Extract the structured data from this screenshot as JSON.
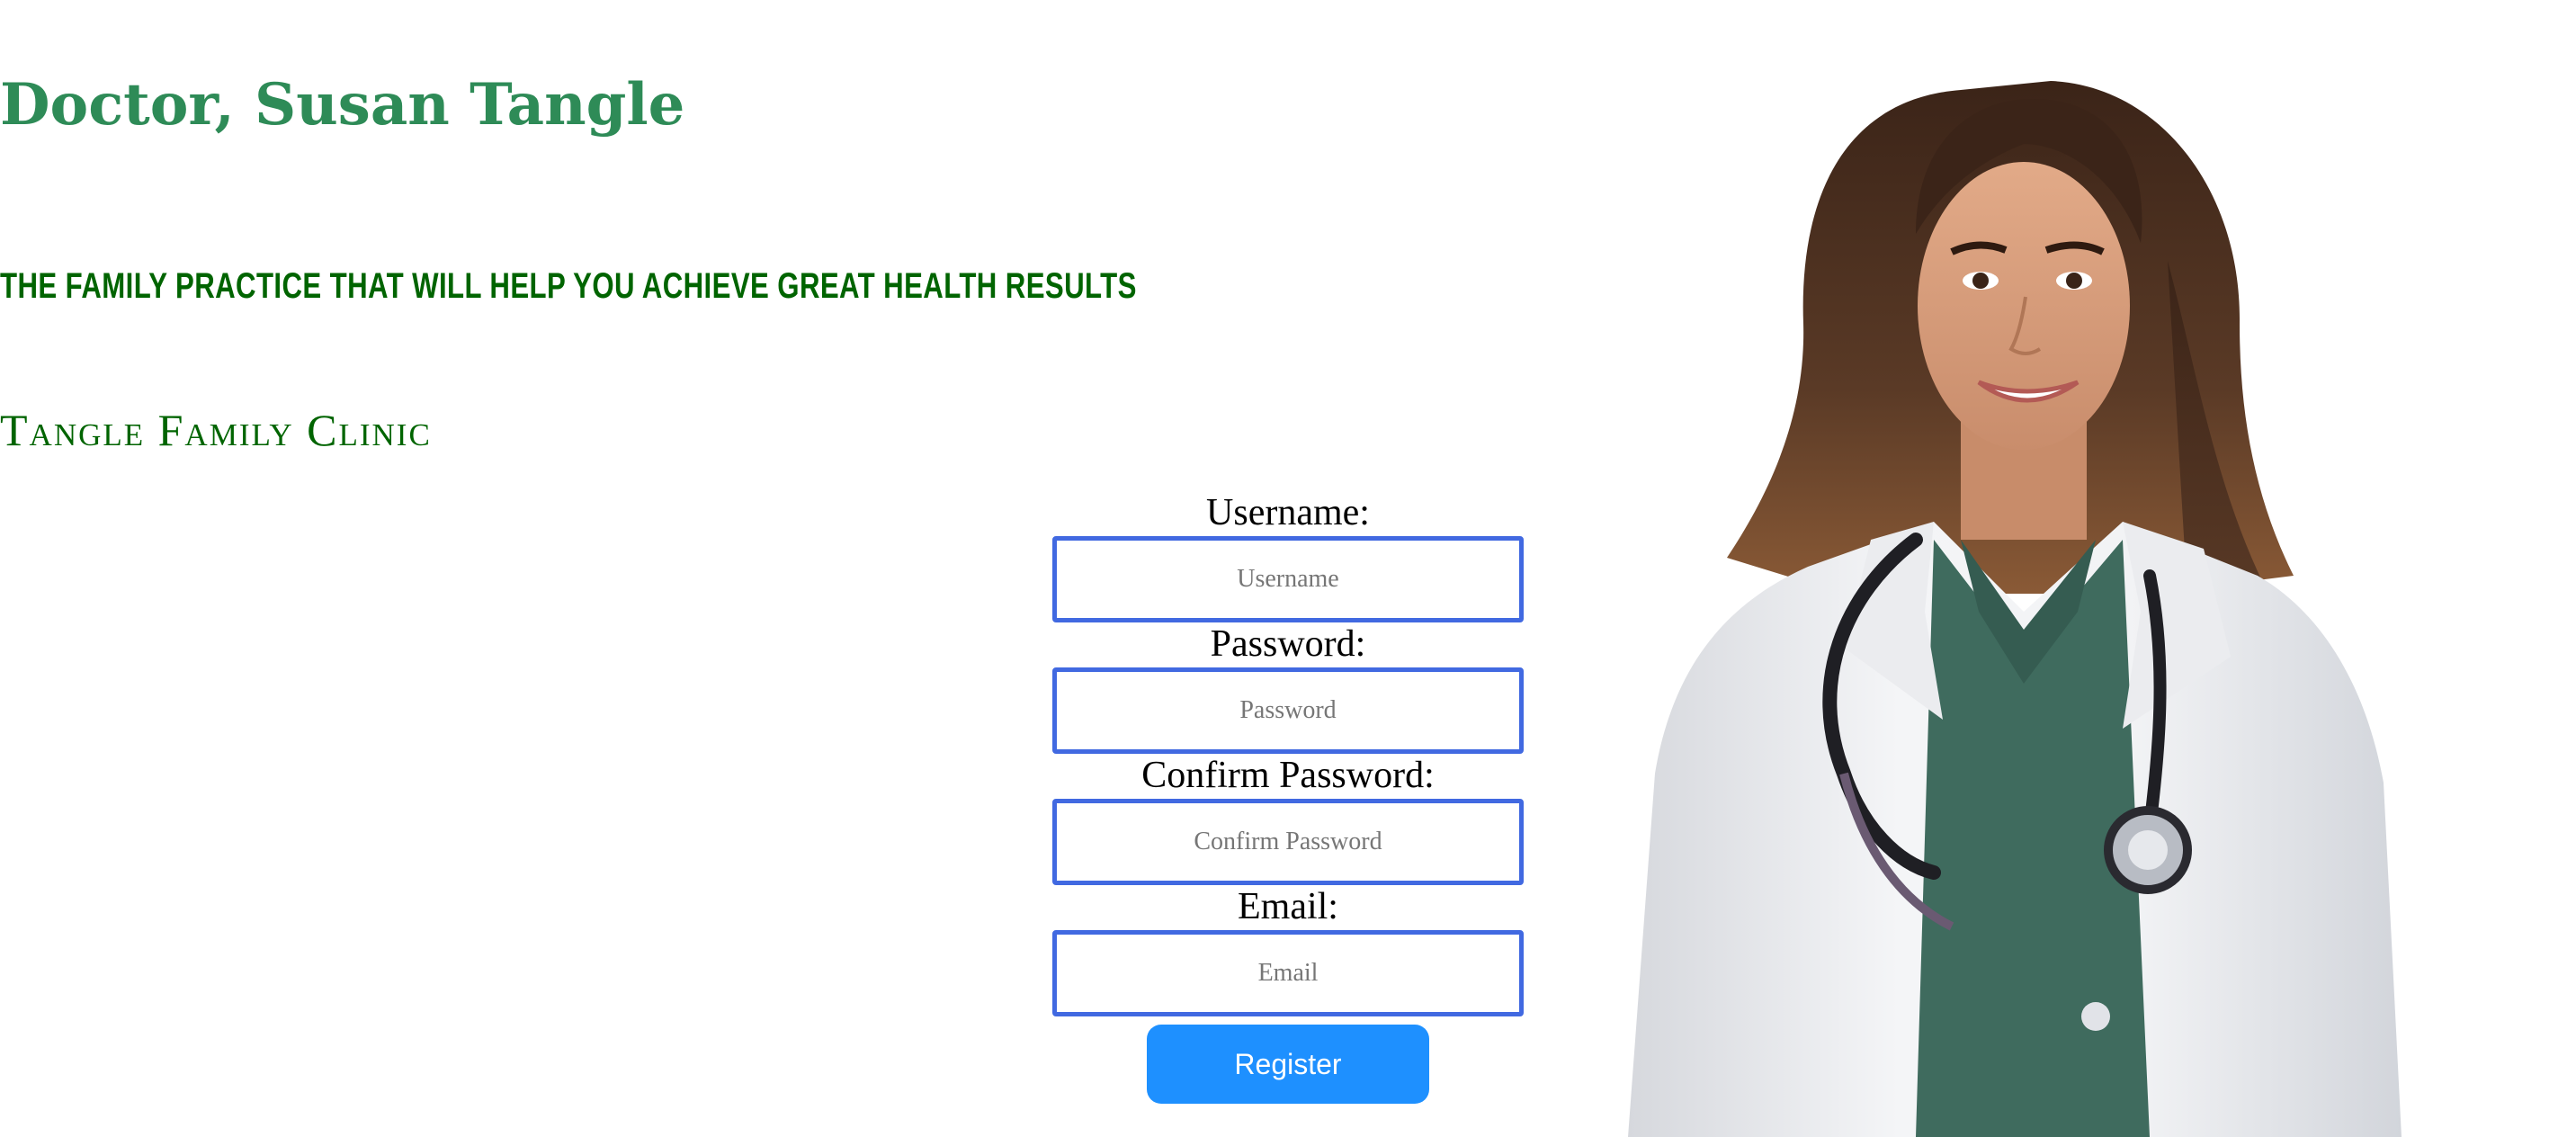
{
  "header": {
    "doctor_name": "Doctor, Susan Tangle",
    "tagline": "The family practice that will help you achieve great health results",
    "clinic_name": "Tangle Family Clinic"
  },
  "form": {
    "username_label": "Username:",
    "username_placeholder": "Username",
    "username_value": "",
    "password_label": "Password:",
    "password_placeholder": "Password",
    "password_value": "",
    "confirm_label": "Confirm Password:",
    "confirm_placeholder": "Confirm Password",
    "confirm_value": "",
    "email_label": "Email:",
    "email_placeholder": "Email",
    "email_value": "",
    "submit_label": "Register"
  },
  "colors": {
    "title_green": "#2e8b57",
    "dark_green": "#006400",
    "input_border": "#4169e1",
    "button_blue": "#1e90ff"
  },
  "image": {
    "subject": "female-doctor-photo",
    "alt": ""
  }
}
